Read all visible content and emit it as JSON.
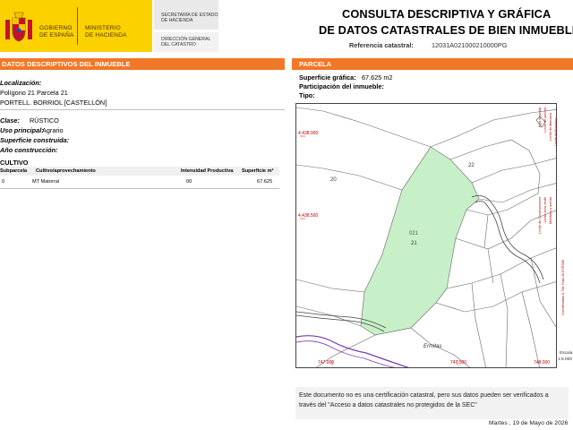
{
  "header": {
    "gobierno": "GOBIERNO\nDE ESPAÑA",
    "ministerio": "MINISTERIO\nDE HACIENDA",
    "secretaria": "SECRETARÍA DE ESTADO\nDE HACIENDA",
    "direccion": "DIRECCIÓN GENERAL\nDEL CATASTRO",
    "title_line1": "CONSULTA DESCRIPTIVA Y GRÁFICA",
    "title_line2": "DE DATOS CATASTRALES DE BIEN INMUEBLE",
    "ref_label": "Referencia catastral:",
    "ref_value": "12031A021000210000PG"
  },
  "left": {
    "section_title": "DATOS DESCRIPTIVOS DEL INMUEBLE",
    "localizacion_label": "Localización:",
    "localizacion_line1": "Polígono 21 Parcela 21",
    "localizacion_line2": "PORTELL. BORRIOL [CASTELLÓN]",
    "clase_label": "Clase:",
    "clase_value": "RÚSTICO",
    "uso_label": "Uso principal:",
    "uso_value": "Agrario",
    "superficie_label": "Superficie construida:",
    "ano_label": "Año construcción:",
    "cultivo_title": "CULTIVO",
    "table_headers": [
      "Subparcela",
      "Cultivo/aprovechamiento",
      "Intensidad Productiva",
      "Superficie m²"
    ],
    "table_rows": [
      {
        "subparcela": "0",
        "cultivo": "MT Matorral",
        "intensidad": "00",
        "superficie": "67.625"
      }
    ]
  },
  "right": {
    "section_title": "PARCELA",
    "sup_grafica_label": "Superficie gráfica:",
    "sup_grafica_value": "67.625 m2",
    "participacion_label": "Participación del inmueble:",
    "tipo_label": "Tipo:"
  },
  "map": {
    "y_label_top": "4.438.000",
    "y_label_mid": "4.438.500",
    "x_label_1": "747.000",
    "x_label_2": "747.500",
    "x_label_3": "748.000",
    "parcel_id": "021",
    "parcel_num": "21",
    "lbl_20": "20",
    "lbl_22": "22",
    "lbl_ermitas": "Ermitas",
    "fill_color": "#c8f0c8"
  },
  "legend": {
    "items": [
      "Hoja segunda",
      "Límite de parcela",
      "Límite de Manzana",
      "Límite de Municipio",
      "Límite de Construcciones",
      "Limite zona verde",
      "Mobiliario y aceras"
    ],
    "coord_note": "Coordenadas U.T.M. Huso 30 ETRS89",
    "escala_label": "Escala",
    "escala_value": "1:5.000"
  },
  "footer": {
    "note_line1": "Este documento no es una certificación catastral, pero sus datos pueden ser verificados a",
    "note_line2": "través del \"Acceso a datos catastrales no protegidos de la SEC\"",
    "date": "Martes , 19 de Mayo de 2026"
  }
}
